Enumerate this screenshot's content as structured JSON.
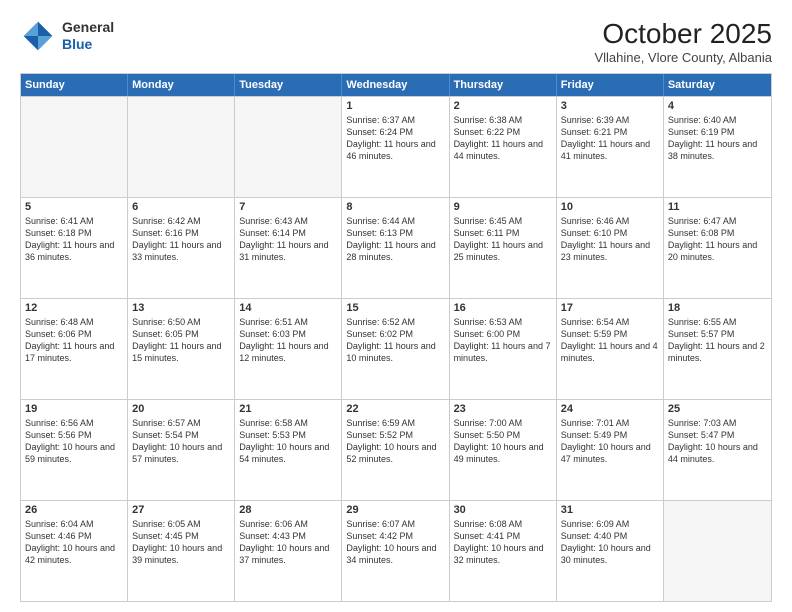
{
  "header": {
    "logo_general": "General",
    "logo_blue": "Blue",
    "month_year": "October 2025",
    "location": "Vllahine, Vlore County, Albania"
  },
  "weekdays": [
    "Sunday",
    "Monday",
    "Tuesday",
    "Wednesday",
    "Thursday",
    "Friday",
    "Saturday"
  ],
  "rows": [
    [
      {
        "day": "",
        "text": "",
        "empty": true
      },
      {
        "day": "",
        "text": "",
        "empty": true
      },
      {
        "day": "",
        "text": "",
        "empty": true
      },
      {
        "day": "1",
        "text": "Sunrise: 6:37 AM\nSunset: 6:24 PM\nDaylight: 11 hours and 46 minutes."
      },
      {
        "day": "2",
        "text": "Sunrise: 6:38 AM\nSunset: 6:22 PM\nDaylight: 11 hours and 44 minutes."
      },
      {
        "day": "3",
        "text": "Sunrise: 6:39 AM\nSunset: 6:21 PM\nDaylight: 11 hours and 41 minutes."
      },
      {
        "day": "4",
        "text": "Sunrise: 6:40 AM\nSunset: 6:19 PM\nDaylight: 11 hours and 38 minutes."
      }
    ],
    [
      {
        "day": "5",
        "text": "Sunrise: 6:41 AM\nSunset: 6:18 PM\nDaylight: 11 hours and 36 minutes."
      },
      {
        "day": "6",
        "text": "Sunrise: 6:42 AM\nSunset: 6:16 PM\nDaylight: 11 hours and 33 minutes."
      },
      {
        "day": "7",
        "text": "Sunrise: 6:43 AM\nSunset: 6:14 PM\nDaylight: 11 hours and 31 minutes."
      },
      {
        "day": "8",
        "text": "Sunrise: 6:44 AM\nSunset: 6:13 PM\nDaylight: 11 hours and 28 minutes."
      },
      {
        "day": "9",
        "text": "Sunrise: 6:45 AM\nSunset: 6:11 PM\nDaylight: 11 hours and 25 minutes."
      },
      {
        "day": "10",
        "text": "Sunrise: 6:46 AM\nSunset: 6:10 PM\nDaylight: 11 hours and 23 minutes."
      },
      {
        "day": "11",
        "text": "Sunrise: 6:47 AM\nSunset: 6:08 PM\nDaylight: 11 hours and 20 minutes."
      }
    ],
    [
      {
        "day": "12",
        "text": "Sunrise: 6:48 AM\nSunset: 6:06 PM\nDaylight: 11 hours and 17 minutes."
      },
      {
        "day": "13",
        "text": "Sunrise: 6:50 AM\nSunset: 6:05 PM\nDaylight: 11 hours and 15 minutes."
      },
      {
        "day": "14",
        "text": "Sunrise: 6:51 AM\nSunset: 6:03 PM\nDaylight: 11 hours and 12 minutes."
      },
      {
        "day": "15",
        "text": "Sunrise: 6:52 AM\nSunset: 6:02 PM\nDaylight: 11 hours and 10 minutes."
      },
      {
        "day": "16",
        "text": "Sunrise: 6:53 AM\nSunset: 6:00 PM\nDaylight: 11 hours and 7 minutes."
      },
      {
        "day": "17",
        "text": "Sunrise: 6:54 AM\nSunset: 5:59 PM\nDaylight: 11 hours and 4 minutes."
      },
      {
        "day": "18",
        "text": "Sunrise: 6:55 AM\nSunset: 5:57 PM\nDaylight: 11 hours and 2 minutes."
      }
    ],
    [
      {
        "day": "19",
        "text": "Sunrise: 6:56 AM\nSunset: 5:56 PM\nDaylight: 10 hours and 59 minutes."
      },
      {
        "day": "20",
        "text": "Sunrise: 6:57 AM\nSunset: 5:54 PM\nDaylight: 10 hours and 57 minutes."
      },
      {
        "day": "21",
        "text": "Sunrise: 6:58 AM\nSunset: 5:53 PM\nDaylight: 10 hours and 54 minutes."
      },
      {
        "day": "22",
        "text": "Sunrise: 6:59 AM\nSunset: 5:52 PM\nDaylight: 10 hours and 52 minutes."
      },
      {
        "day": "23",
        "text": "Sunrise: 7:00 AM\nSunset: 5:50 PM\nDaylight: 10 hours and 49 minutes."
      },
      {
        "day": "24",
        "text": "Sunrise: 7:01 AM\nSunset: 5:49 PM\nDaylight: 10 hours and 47 minutes."
      },
      {
        "day": "25",
        "text": "Sunrise: 7:03 AM\nSunset: 5:47 PM\nDaylight: 10 hours and 44 minutes."
      }
    ],
    [
      {
        "day": "26",
        "text": "Sunrise: 6:04 AM\nSunset: 4:46 PM\nDaylight: 10 hours and 42 minutes."
      },
      {
        "day": "27",
        "text": "Sunrise: 6:05 AM\nSunset: 4:45 PM\nDaylight: 10 hours and 39 minutes."
      },
      {
        "day": "28",
        "text": "Sunrise: 6:06 AM\nSunset: 4:43 PM\nDaylight: 10 hours and 37 minutes."
      },
      {
        "day": "29",
        "text": "Sunrise: 6:07 AM\nSunset: 4:42 PM\nDaylight: 10 hours and 34 minutes."
      },
      {
        "day": "30",
        "text": "Sunrise: 6:08 AM\nSunset: 4:41 PM\nDaylight: 10 hours and 32 minutes."
      },
      {
        "day": "31",
        "text": "Sunrise: 6:09 AM\nSunset: 4:40 PM\nDaylight: 10 hours and 30 minutes."
      },
      {
        "day": "",
        "text": "",
        "empty": true
      }
    ]
  ]
}
